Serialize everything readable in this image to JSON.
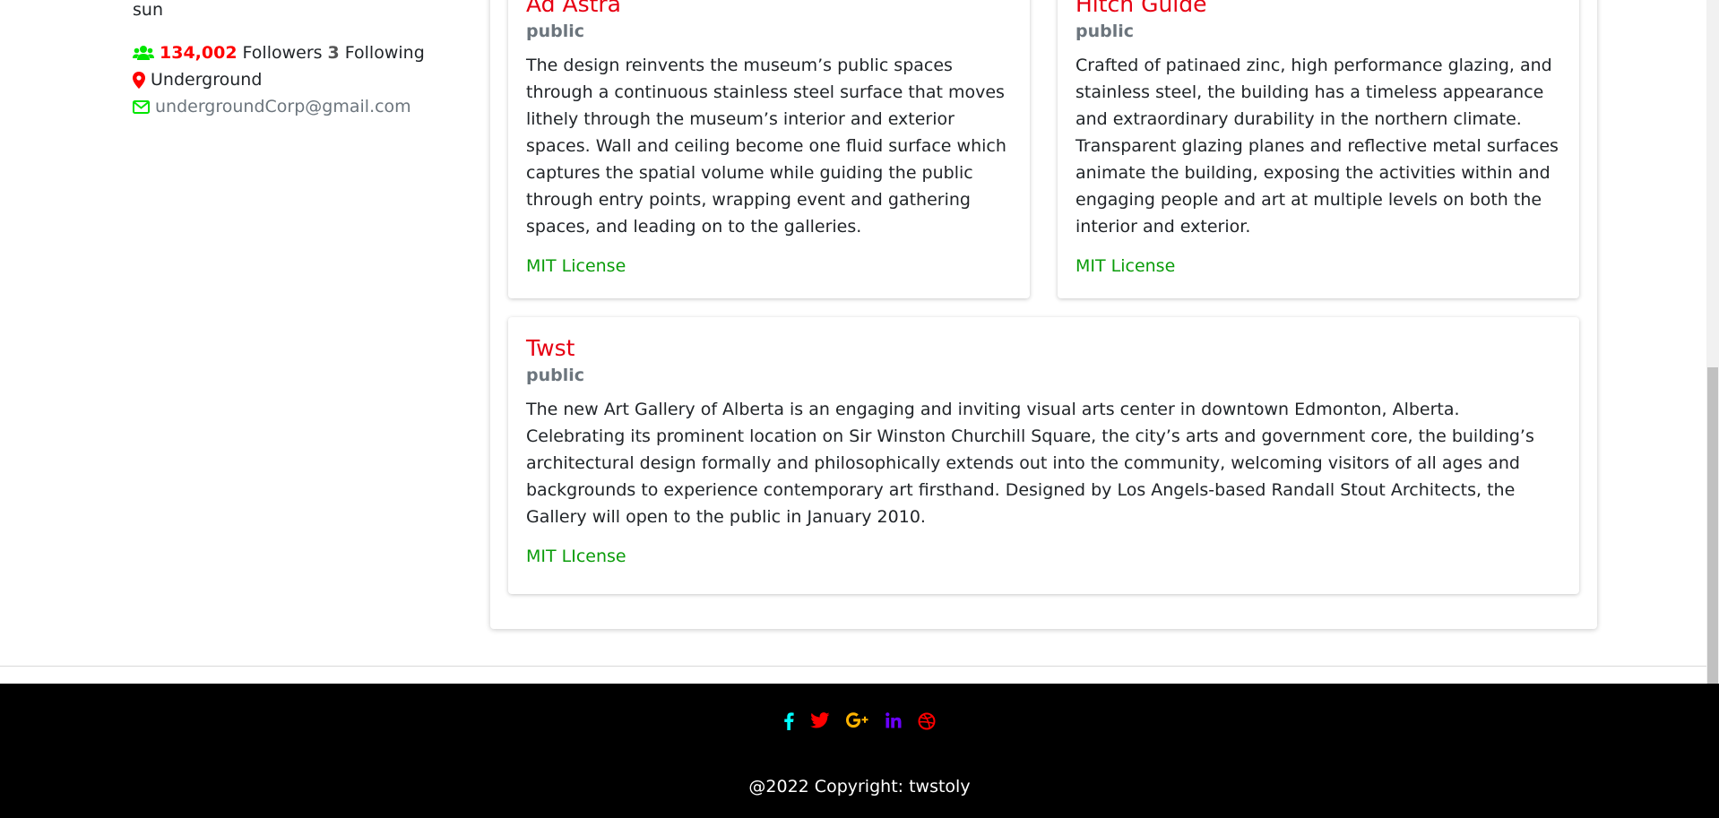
{
  "profile": {
    "bio": "sun",
    "followers_count": "134,002",
    "followers_label": "Followers",
    "following_count": "3",
    "following_label": "Following",
    "location": "Underground",
    "email": "undergroundCorp@gmail.com",
    "icons": {
      "followers": "users-icon",
      "location": "map-marker-icon",
      "email": "envelope-icon"
    },
    "colors": {
      "icon_green": "#00e600",
      "icon_red": "#ff0000",
      "count_red": "#ff0000"
    }
  },
  "repos": [
    {
      "title": "Ad Astra",
      "visibility": "public",
      "description": "The design reinvents the museum’s public spaces through a continuous stainless steel surface that moves lithely through the museum’s interior and exterior spaces. Wall and ceiling become one fluid surface which captures the spatial volume while guiding the public through entry points, wrapping event and gathering spaces, and leading on to the galleries.",
      "license": "MIT License"
    },
    {
      "title": "Hitch Guide",
      "visibility": "public",
      "description": "Crafted of patinaed zinc, high performance glazing, and stainless steel, the building has a timeless appearance and extraordinary durability in the northern climate. Transparent glazing planes and reflective metal surfaces animate the building, exposing the activities within and engaging people and art at multiple levels on both the interior and exterior.",
      "license": "MIT License"
    },
    {
      "title": "Twst",
      "visibility": "public",
      "description": "The new Art Gallery of Alberta is an engaging and inviting visual arts center in downtown Edmonton, Alberta. Celebrating its prominent location on Sir Winston Churchill Square, the city’s arts and government core, the building’s architectural design formally and philosophically extends out into the community, welcoming visitors of all ages and backgrounds to experience contemporary art firsthand. Designed by Los Angels-based Randall Stout Architects, the Gallery will open to the public in January 2010.",
      "license": "MIT LIcense"
    }
  ],
  "repo_colors": {
    "title": "#e60012",
    "visibility": "#6c757d",
    "license": "#0a9c0a"
  },
  "footer": {
    "social_icons": [
      {
        "name": "facebook-icon",
        "color": "#00ffff"
      },
      {
        "name": "twitter-icon",
        "color": "#ff0000"
      },
      {
        "name": "google-plus-icon",
        "color": "#ffb300"
      },
      {
        "name": "linkedin-icon",
        "color": "#6a00ff"
      },
      {
        "name": "dribbble-icon",
        "color": "#ff0000"
      }
    ],
    "copyright": "@2022 Copyright: twstoly"
  }
}
